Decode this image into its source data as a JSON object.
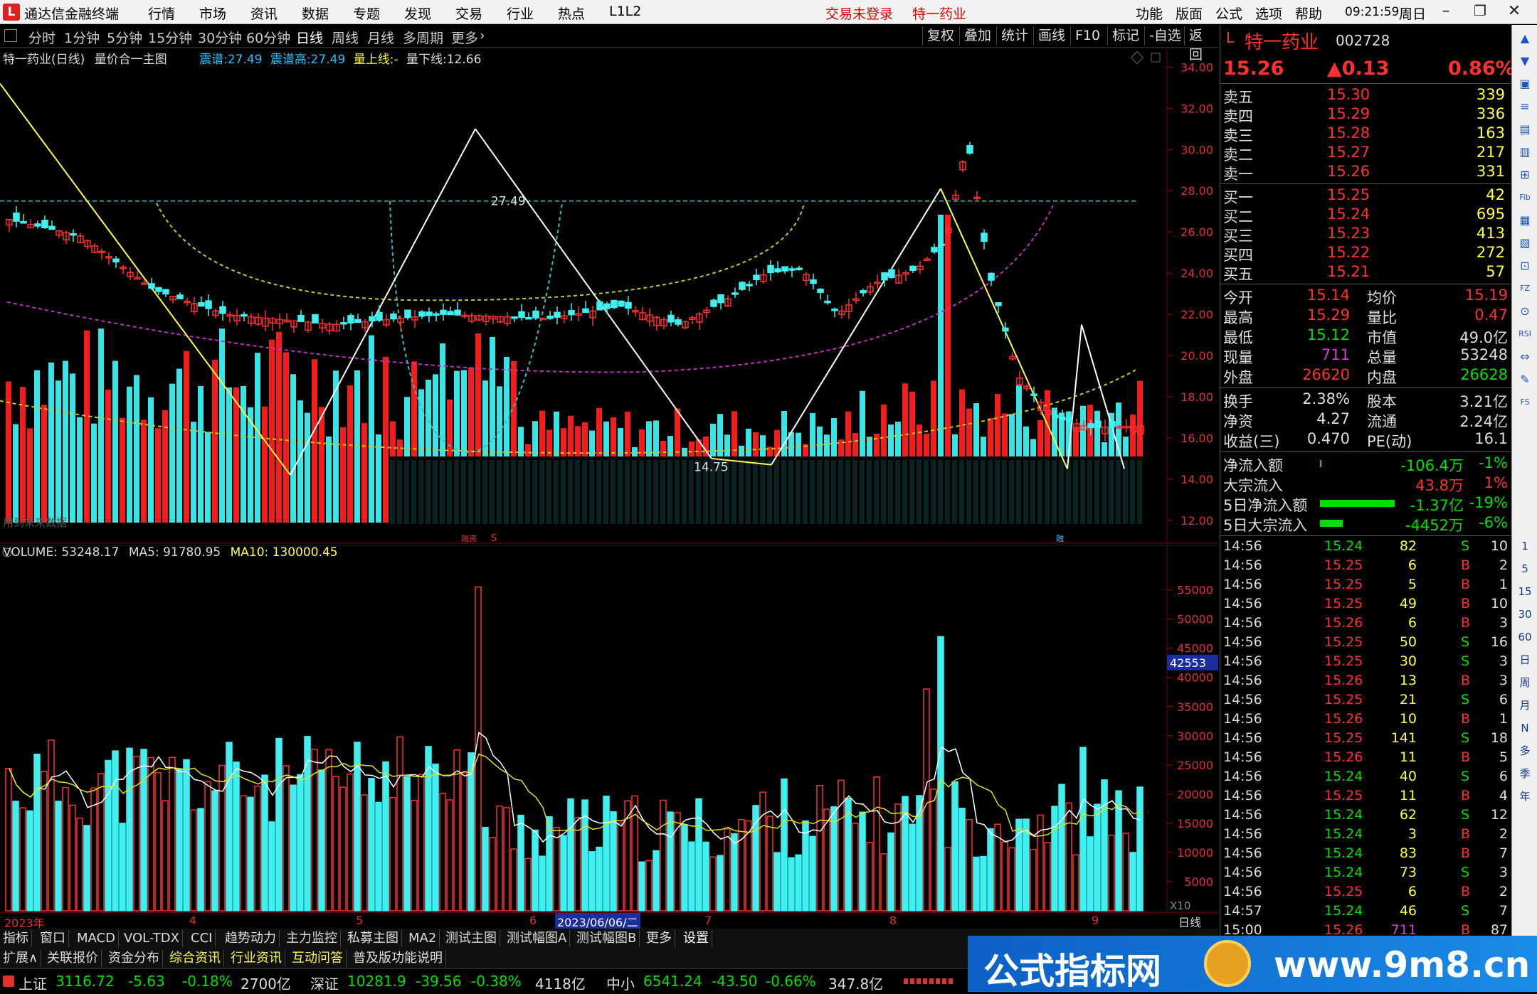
{
  "titlebar": {
    "app_name": "通达信金融终端",
    "menus": [
      "行情",
      "市场",
      "资讯",
      "数据",
      "专题",
      "发现",
      "交易",
      "行业",
      "热点",
      "L1L2"
    ],
    "login_status": "交易未登录",
    "stock_title": "特一药业",
    "right_menus": [
      "功能",
      "版面",
      "公式",
      "选项",
      "帮助"
    ],
    "time": "09:21:59",
    "weekday": "周日"
  },
  "periodbar": {
    "periods": [
      "分时",
      "1分钟",
      "5分钟",
      "15分钟",
      "30分钟",
      "60分钟",
      "日线",
      "周线",
      "月线",
      "多周期",
      "更多"
    ],
    "active": "日线",
    "right_buttons": [
      "复权",
      "叠加",
      "统计",
      "画线",
      "F10",
      "标记",
      "-自选",
      "返回"
    ]
  },
  "main_chart": {
    "title": "特一药业(日线)",
    "indicator": "量价合一主图",
    "params": [
      {
        "label": "震谱:",
        "value": "27.49",
        "color": "#20c0ff"
      },
      {
        "label": "震谱高:",
        "value": "27.49",
        "color": "#20c0ff"
      },
      {
        "label": "量上线:",
        "value": "-",
        "color": "#ffff40"
      },
      {
        "label": "量下线:",
        "value": "12.66",
        "color": "#ddd"
      }
    ],
    "price_axis": [
      "34.00",
      "32.00",
      "30.00",
      "28.00",
      "26.00",
      "24.00",
      "22.00",
      "20.00",
      "18.00",
      "16.00",
      "14.00",
      "12.00"
    ],
    "annotations": [
      "27.49",
      "14.75"
    ],
    "footnote": "用到未来数据",
    "badges": [
      "融资",
      "S",
      "融"
    ]
  },
  "vol_chart": {
    "title": "VOLUME: 53248.17",
    "ma5": "MA5: 91780.95",
    "ma10": "MA10: 130000.45",
    "axis": [
      "55000",
      "50000",
      "45000",
      "40000",
      "35000",
      "30000",
      "25000",
      "20000",
      "15000",
      "10000",
      "5000"
    ],
    "current_tag": "42553",
    "unit": "X10"
  },
  "date_axis": {
    "labels": [
      "2023年",
      "4",
      "5",
      "6",
      "7",
      "8",
      "9"
    ],
    "cursor_date": "2023/06/06/二",
    "period_label": "日线"
  },
  "tabs_row1": [
    "指标",
    "窗口",
    "MACD",
    "VOL-TDX",
    "CCI",
    "趋势动力",
    "主力监控",
    "私募主图",
    "MA2",
    "测试主图",
    "测试幅图A",
    "测试幅图B",
    "更多",
    "设置"
  ],
  "tabs_row2": [
    "扩展∧",
    "关联报价",
    "资金分布",
    "综合资讯",
    "行业资讯",
    "互动问答",
    "普及版功能说明"
  ],
  "statusbar": {
    "indices": [
      {
        "name": "上证",
        "value": "3116.72",
        "change": "-5.63",
        "pct": "-0.18%",
        "amount": "2700亿"
      },
      {
        "name": "深证",
        "value": "10281.9",
        "change": "-39.56",
        "pct": "-0.38%",
        "amount": "4118亿"
      },
      {
        "name": "中小",
        "value": "6541.24",
        "change": "-43.50",
        "pct": "-0.66%",
        "amount": "347.8亿"
      }
    ]
  },
  "quote": {
    "name": "特一药业",
    "code": "002728",
    "price": "15.26",
    "change": "▲0.13",
    "pct": "0.86%",
    "asks": [
      {
        "label": "卖五",
        "price": "15.30",
        "vol": "339"
      },
      {
        "label": "卖四",
        "price": "15.29",
        "vol": "336"
      },
      {
        "label": "卖三",
        "price": "15.28",
        "vol": "163"
      },
      {
        "label": "卖二",
        "price": "15.27",
        "vol": "217"
      },
      {
        "label": "卖一",
        "price": "15.26",
        "vol": "331"
      }
    ],
    "bids": [
      {
        "label": "买一",
        "price": "15.25",
        "vol": "42"
      },
      {
        "label": "买二",
        "price": "15.24",
        "vol": "695"
      },
      {
        "label": "买三",
        "price": "15.23",
        "vol": "413"
      },
      {
        "label": "买四",
        "price": "15.22",
        "vol": "272"
      },
      {
        "label": "买五",
        "price": "15.21",
        "vol": "57"
      }
    ],
    "stats": [
      [
        "今开",
        "15.14",
        "均价",
        "15.19"
      ],
      [
        "最高",
        "15.29",
        "量比",
        "0.47"
      ],
      [
        "最低",
        "15.12",
        "市值",
        "49.0亿"
      ],
      [
        "现量",
        "711",
        "总量",
        "53248"
      ],
      [
        "外盘",
        "26620",
        "内盘",
        "26628"
      ]
    ],
    "stats2": [
      [
        "换手",
        "2.38%",
        "股本",
        "3.21亿"
      ],
      [
        "净资",
        "4.27",
        "流通",
        "2.24亿"
      ],
      [
        "收益(三)",
        "0.470",
        "PE(动)",
        "16.1"
      ]
    ],
    "flows": [
      {
        "label": "净流入额",
        "value": "-106.4万",
        "pct": "-1%"
      },
      {
        "label": "大宗流入",
        "value": "43.8万",
        "pct": "1%"
      },
      {
        "label": "5日净流入额",
        "value": "-1.37亿",
        "pct": "-19%"
      },
      {
        "label": "5日大宗流入",
        "value": "-4452万",
        "pct": "-6%"
      }
    ],
    "ticks": [
      [
        "14:56",
        "15.24",
        "82",
        "S",
        "10"
      ],
      [
        "14:56",
        "15.25",
        "6",
        "B",
        "2"
      ],
      [
        "14:56",
        "15.25",
        "5",
        "B",
        "1"
      ],
      [
        "14:56",
        "15.25",
        "49",
        "B",
        "10"
      ],
      [
        "14:56",
        "15.26",
        "6",
        "B",
        "3"
      ],
      [
        "14:56",
        "15.25",
        "50",
        "S",
        "16"
      ],
      [
        "14:56",
        "15.25",
        "30",
        "S",
        "3"
      ],
      [
        "14:56",
        "15.26",
        "13",
        "B",
        "3"
      ],
      [
        "14:56",
        "15.25",
        "21",
        "S",
        "6"
      ],
      [
        "14:56",
        "15.26",
        "10",
        "B",
        "1"
      ],
      [
        "14:56",
        "15.25",
        "141",
        "S",
        "18"
      ],
      [
        "14:56",
        "15.26",
        "11",
        "B",
        "5"
      ],
      [
        "14:56",
        "15.24",
        "40",
        "S",
        "6"
      ],
      [
        "14:56",
        "15.25",
        "11",
        "B",
        "4"
      ],
      [
        "14:56",
        "15.24",
        "62",
        "S",
        "12"
      ],
      [
        "14:56",
        "15.24",
        "3",
        "B",
        "2"
      ],
      [
        "14:56",
        "15.24",
        "83",
        "B",
        "7"
      ],
      [
        "14:56",
        "15.24",
        "73",
        "S",
        "3"
      ],
      [
        "14:56",
        "15.25",
        "6",
        "B",
        "2"
      ],
      [
        "14:57",
        "15.24",
        "46",
        "S",
        "7"
      ],
      [
        "15:00",
        "15.26",
        "711",
        "B",
        "87"
      ]
    ]
  },
  "side_icons": [
    "1",
    "5",
    "15",
    "30",
    "60",
    "日",
    "周",
    "月",
    "N",
    "多",
    "季",
    "年"
  ],
  "watermark": {
    "left": "公式指标网",
    "right": "www.9m8.cn"
  }
}
